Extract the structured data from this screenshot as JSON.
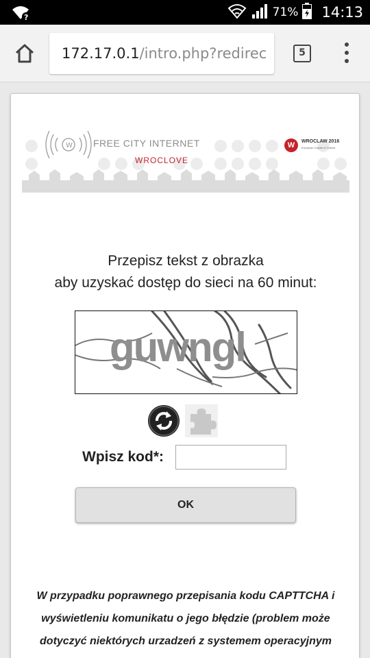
{
  "status_bar": {
    "battery_percent": "71%",
    "time": "14:13",
    "icons": [
      "wifi-question-icon",
      "wifi-icon",
      "signal-icon",
      "battery-icon"
    ]
  },
  "browser": {
    "url_host": "172.17.0.1",
    "url_path": "/intro.php?redirec",
    "tab_count": "5",
    "icons": [
      "home-icon",
      "tabs-icon",
      "menu-icon"
    ]
  },
  "banner": {
    "title": "FREE CITY INTERNET",
    "subtitle": "WROCLOVE",
    "partner": "WROCLAW 2016",
    "partner_sub": "European Capital of Culture",
    "colors": {
      "accent": "#c4232a",
      "gray": "#8c8c8c"
    }
  },
  "form": {
    "instruction_line1": "Przepisz tekst z obrazka",
    "instruction_line2": "aby uzyskać dostęp do sieci na 60 minut:",
    "captcha_text": "guwngl",
    "code_label": "Wpisz kod*:",
    "code_value": "",
    "ok_label": "OK"
  },
  "note": {
    "text": "W przypadku poprawnego przepisania kodu CAPTTCHA i wyświetleniu komunikatu o jego błędzie (problem może dotyczyć niektórych urzadzeń z systemem operacyjnym"
  }
}
